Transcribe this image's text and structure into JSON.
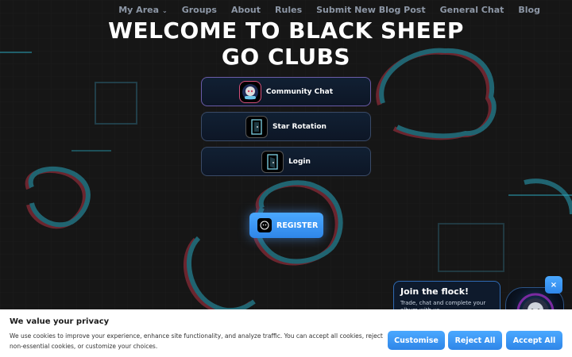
{
  "nav": {
    "items": [
      "My Area",
      "Groups",
      "About",
      "Rules",
      "Submit New Blog Post",
      "General Chat",
      "Blog"
    ]
  },
  "hero": {
    "title_line1": "WELCOME TO BLACK SHEEP",
    "title_line2": "GO CLUBS"
  },
  "menu": {
    "buttons": [
      {
        "label": "Community Chat",
        "icon": "sheep-avatar-icon"
      },
      {
        "label": "Star Rotation",
        "icon": "door-icon"
      },
      {
        "label": "Login",
        "icon": "door-icon"
      }
    ],
    "register_label": "REGISTER",
    "register_icon": "sheep-head-icon"
  },
  "flock_popup": {
    "title": "Join the flock!",
    "text": "Trade, chat and complete your album with us",
    "close_label": "×"
  },
  "cookie_banner": {
    "title": "We value your privacy",
    "text": "We use cookies to improve your experience, enhance site functionality, and analyze traffic. You can accept all cookies, reject non-essential cookies, or customize your choices.",
    "customise_label": "Customise",
    "reject_label": "Reject All",
    "accept_label": "Accept All"
  },
  "colors": {
    "background": "#171717",
    "accent": "#3a9af5",
    "nav_text": "#8d97a6",
    "outline_cyan": "#2bb3c8",
    "outline_red": "#c03a4a"
  }
}
